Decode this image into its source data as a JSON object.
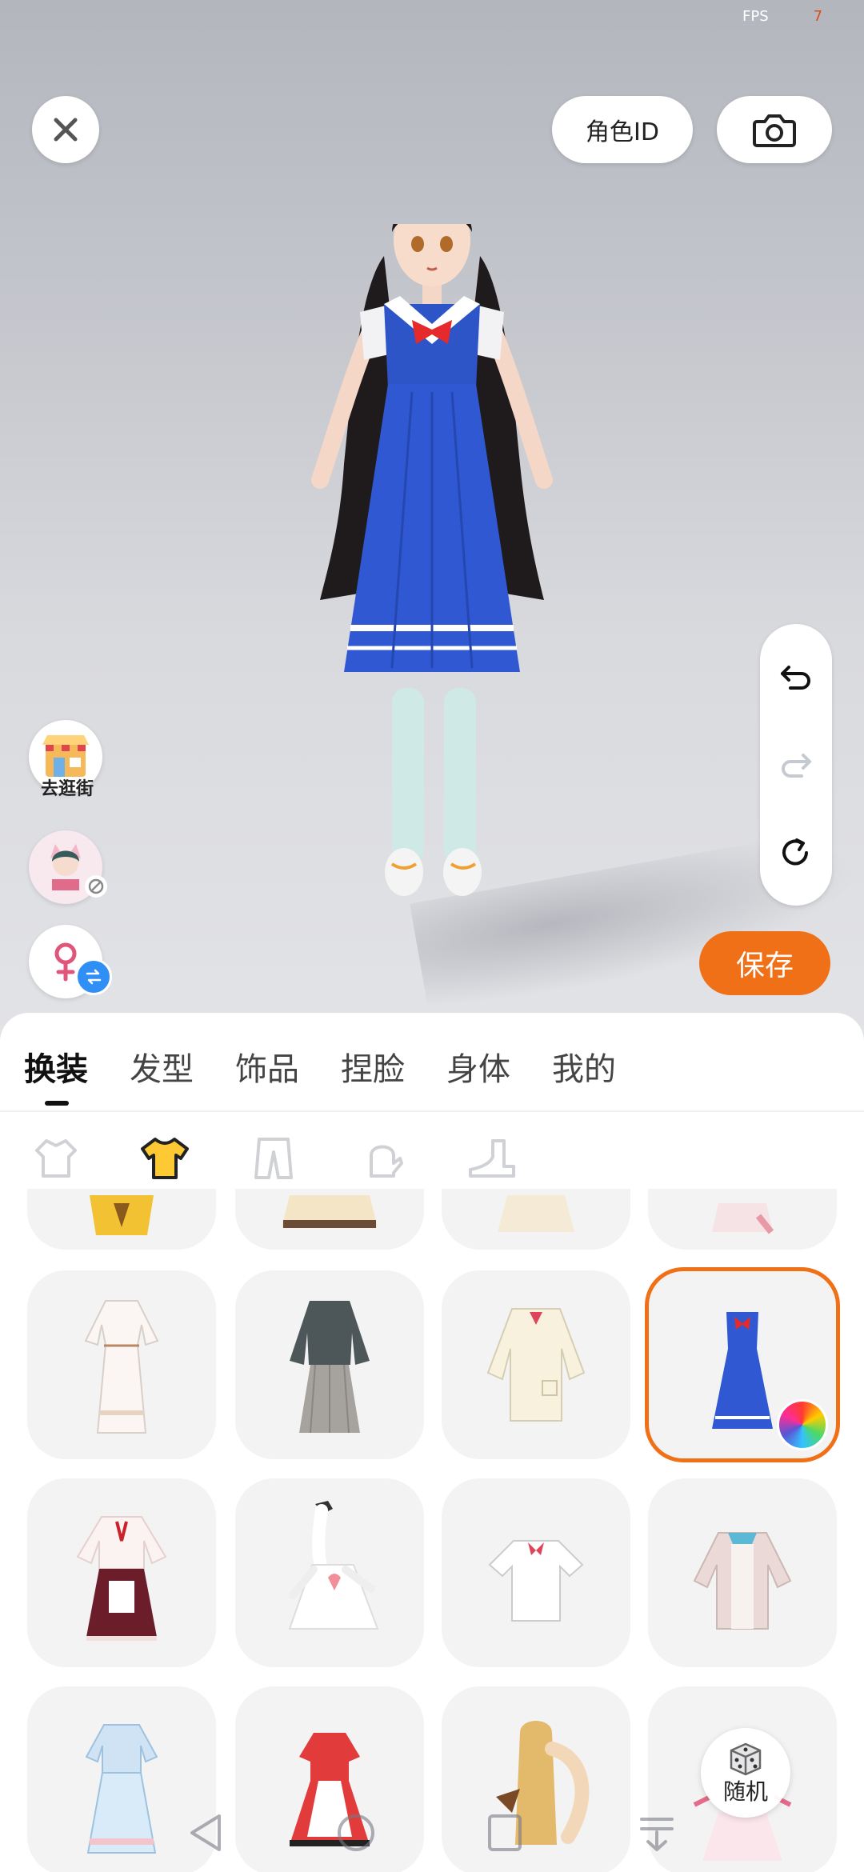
{
  "status": {
    "fps_label": "FPS",
    "fps_value": "7"
  },
  "header": {
    "role_id_label": "角色ID",
    "close_icon": "close-icon",
    "camera_icon": "camera-icon"
  },
  "side": {
    "shop_label": "去逛街",
    "gender_icon": "female-icon",
    "swap_icon": "swap-icon"
  },
  "edit": {
    "undo": "undo-icon",
    "redo": "redo-icon",
    "reset": "reset-icon"
  },
  "save_label": "保存",
  "tabs": [
    {
      "label": "换装",
      "active": true
    },
    {
      "label": "发型",
      "active": false
    },
    {
      "label": "饰品",
      "active": false
    },
    {
      "label": "捏脸",
      "active": false
    },
    {
      "label": "身体",
      "active": false
    },
    {
      "label": "我的",
      "active": false
    }
  ],
  "subcategories": [
    "outfit-icon",
    "top-icon",
    "pants-icon",
    "glove-icon",
    "shoe-icon"
  ],
  "subcategory_active_index": 1,
  "random_label": "随机",
  "accent_color": "#f07017"
}
